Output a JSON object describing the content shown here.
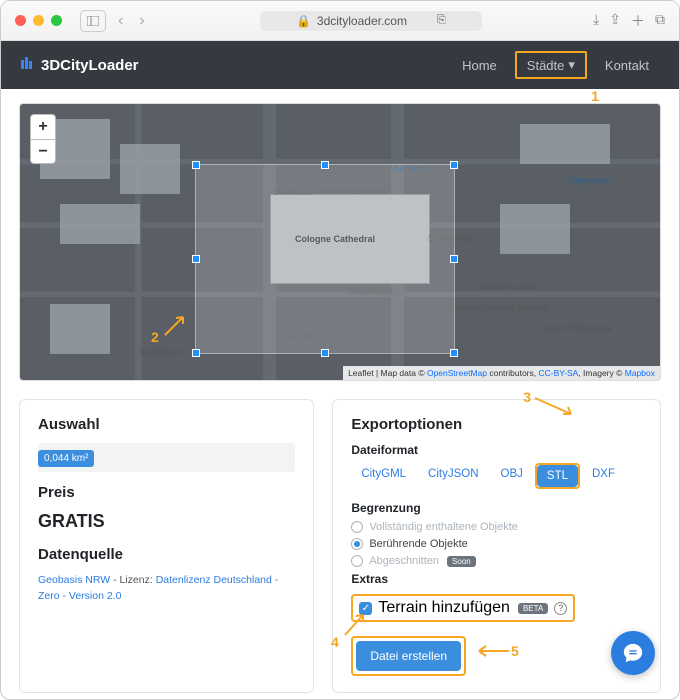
{
  "browser": {
    "url_host": "3dcityloader.com",
    "lock": "🔒"
  },
  "nav": {
    "brand": "3DCityLoader",
    "home": "Home",
    "cities": "Städte",
    "contact": "Kontakt"
  },
  "map": {
    "zoom_in": "+",
    "zoom_out": "−",
    "attribution_prefix": "Leaflet",
    "attribution_mid": " | Map data © ",
    "osm": "OpenStreetMap",
    "contrib": " contributors, ",
    "ccby": "CC-BY-SA",
    "imagery": ", Imagery © ",
    "mapbox": "Mapbox",
    "label_cathedral": "Cologne Cathedral",
    "label_domschatz": "Domschatzkammer",
    "label_roncalli": "Roncalliplatz",
    "label_ludwig": "Museum Ludwig",
    "label_roman": "Roman-Germanic Museum",
    "label_philh": "Kölner Philharmonie",
    "label_amhof": "Am Hof",
    "label_amdom": "Am Dom",
    "label_trankg": "Trankgasse",
    "label_dom": "Domkloster",
    "label_wallraf": "Wallrafplatz",
    "label_stmaria": "St. Maria ad"
  },
  "leftPanel": {
    "selection_title": "Auswahl",
    "area": "0,044 km²",
    "price_title": "Preis",
    "price_value": "GRATIS",
    "source_title": "Datenquelle",
    "src1": "Geobasis NRW",
    "src2": " - Lizenz: ",
    "src3": "Datenlizenz Deutschland - Zero - Version 2.0"
  },
  "rightPanel": {
    "title": "Exportoptionen",
    "format_title": "Dateiformat",
    "formats": {
      "citygml": "CityGML",
      "cityjson": "CityJSON",
      "obj": "OBJ",
      "stl": "STL",
      "dxf": "DXF"
    },
    "bounds_title": "Begrenzung",
    "bound_full": "Vollständig enthaltene Objekte",
    "bound_touch": "Berührende Objekte",
    "bound_clip": "Abgeschnitten",
    "soon": "Soon",
    "extras_title": "Extras",
    "terrain_label": "Terrain hinzufügen",
    "beta": "BETA",
    "create_btn": "Datei erstellen"
  },
  "annotations": {
    "n1": "1",
    "n2": "2",
    "n3": "3",
    "n4": "4",
    "n5": "5"
  }
}
